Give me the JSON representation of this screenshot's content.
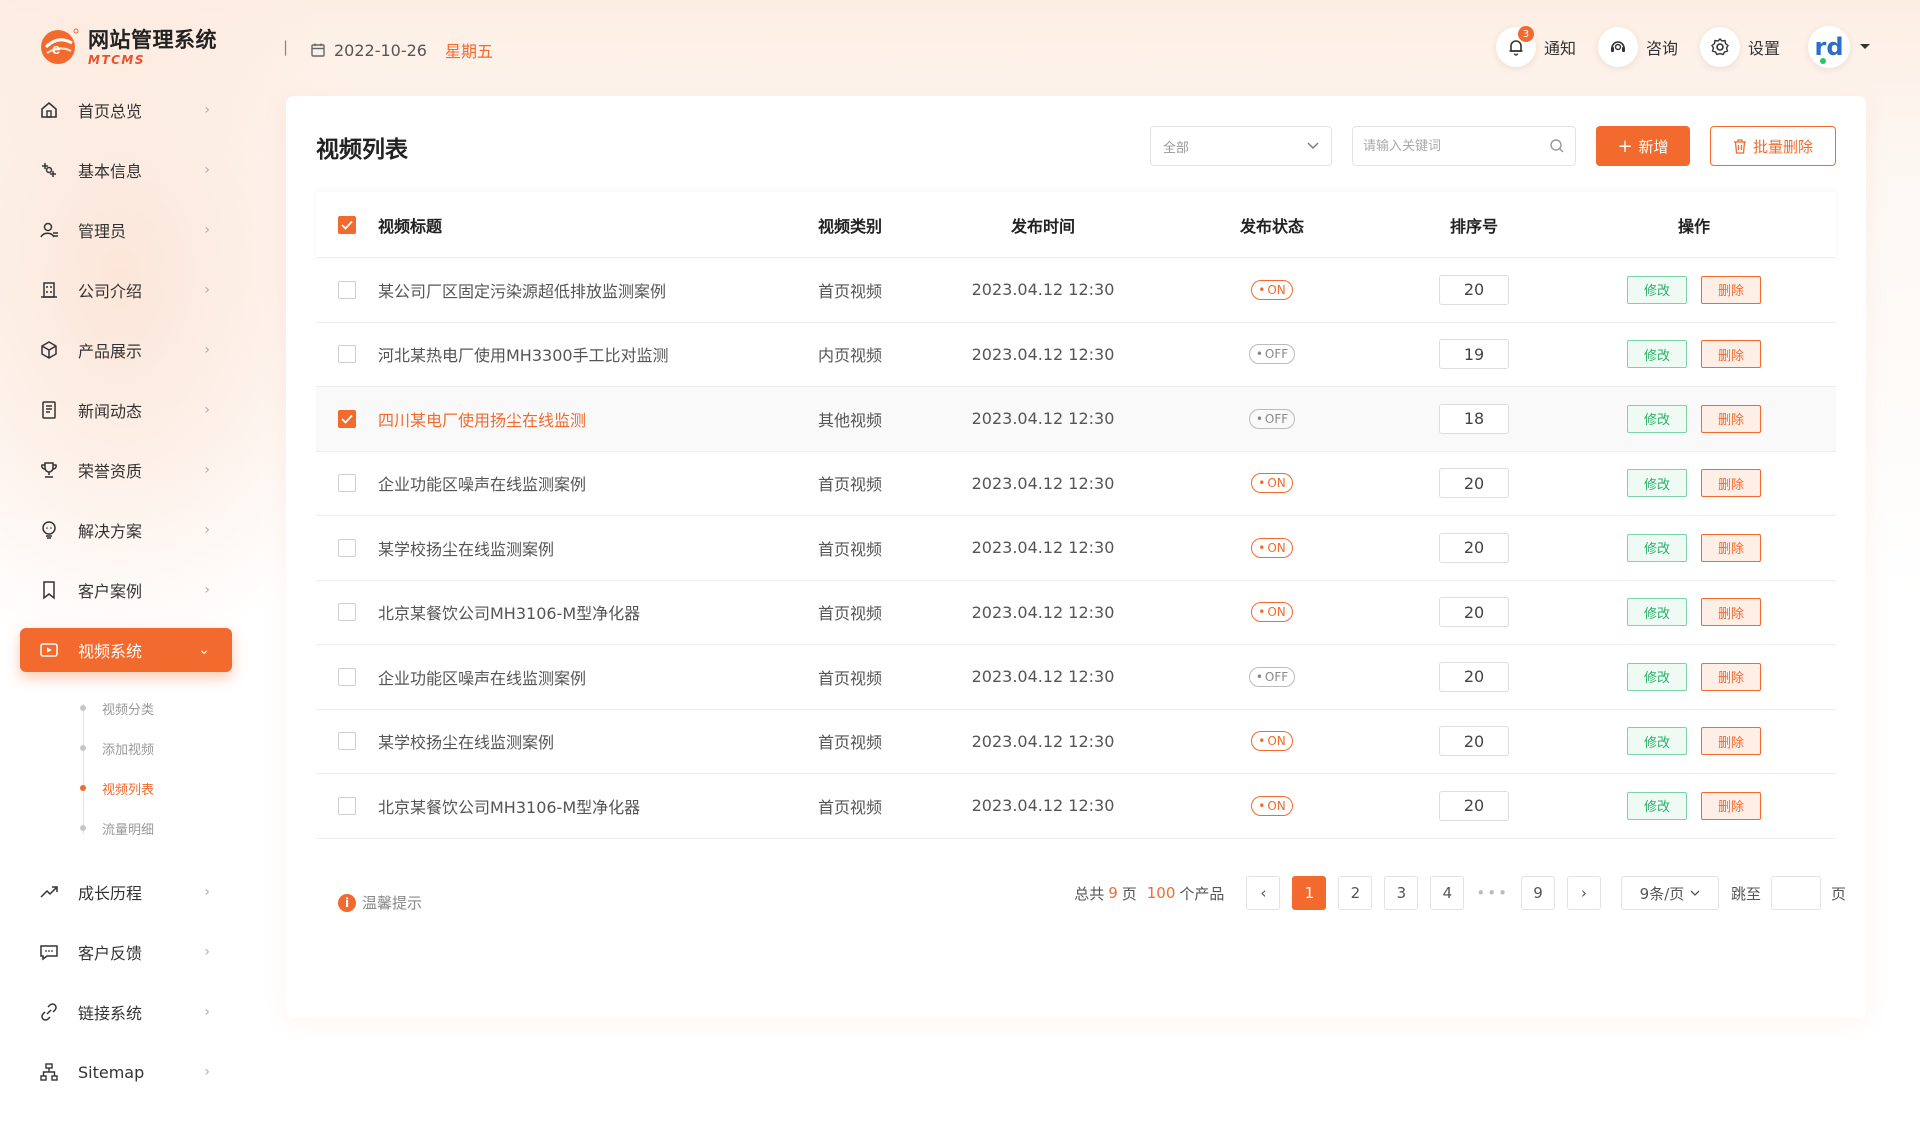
{
  "app": {
    "name_cn": "网站管理系统",
    "name_en": "MTCMS",
    "brand_color": "#f26a2e"
  },
  "header": {
    "separator": "|",
    "date": "2022-10-26",
    "weekday": "星期五",
    "notify_label": "通知",
    "notify_count": "3",
    "consult_label": "咨询",
    "settings_label": "设置",
    "avatar_text": "rd"
  },
  "sidebar": {
    "items": [
      {
        "label": "首页总览",
        "icon": "home-icon"
      },
      {
        "label": "基本信息",
        "icon": "info-icon"
      },
      {
        "label": "管理员",
        "icon": "admin-icon"
      },
      {
        "label": "公司介绍",
        "icon": "building-icon"
      },
      {
        "label": "产品展示",
        "icon": "box-icon"
      },
      {
        "label": "新闻动态",
        "icon": "news-icon"
      },
      {
        "label": "荣誉资质",
        "icon": "trophy-icon"
      },
      {
        "label": "解决方案",
        "icon": "solution-icon"
      },
      {
        "label": "客户案例",
        "icon": "bookmark-icon"
      },
      {
        "label": "视频系统",
        "icon": "video-icon",
        "active": true
      },
      {
        "label": "成长历程",
        "icon": "trend-icon"
      },
      {
        "label": "客户反馈",
        "icon": "message-icon"
      },
      {
        "label": "链接系统",
        "icon": "link-icon"
      },
      {
        "label": "Sitemap",
        "icon": "sitemap-icon"
      }
    ],
    "video_sub": [
      "视频分类",
      "添加视频",
      "视频列表",
      "流量明细"
    ],
    "video_sub_active": "视频列表"
  },
  "main": {
    "title": "视频列表",
    "filter_value": "全部",
    "search_placeholder": "请输入关键词",
    "add_label": "新增",
    "batch_delete_label": "批量删除",
    "columns": [
      "视频标题",
      "视频类别",
      "发布时间",
      "发布状态",
      "排序号",
      "操作"
    ],
    "rows": [
      {
        "title": "某公司厂区固定污染源超低排放监测案例",
        "category": "首页视频",
        "time": "2023.04.12 12:30",
        "status": "ON",
        "order": "20",
        "selected": false
      },
      {
        "title": "河北某热电厂使用MH3300手工比对监测",
        "category": "内页视频",
        "time": "2023.04.12 12:30",
        "status": "OFF",
        "order": "19",
        "selected": false
      },
      {
        "title": "四川某电厂使用扬尘在线监测",
        "category": "其他视频",
        "time": "2023.04.12 12:30",
        "status": "OFF",
        "order": "18",
        "selected": true
      },
      {
        "title": "企业功能区噪声在线监测案例",
        "category": "首页视频",
        "time": "2023.04.12 12:30",
        "status": "ON",
        "order": "20",
        "selected": false
      },
      {
        "title": "某学校扬尘在线监测案例",
        "category": "首页视频",
        "time": "2023.04.12 12:30",
        "status": "ON",
        "order": "20",
        "selected": false
      },
      {
        "title": "北京某餐饮公司MH3106-M型净化器",
        "category": "首页视频",
        "time": "2023.04.12 12:30",
        "status": "ON",
        "order": "20",
        "selected": false
      },
      {
        "title": "企业功能区噪声在线监测案例",
        "category": "首页视频",
        "time": "2023.04.12 12:30",
        "status": "OFF",
        "order": "20",
        "selected": false
      },
      {
        "title": "某学校扬尘在线监测案例",
        "category": "首页视频",
        "time": "2023.04.12 12:30",
        "status": "ON",
        "order": "20",
        "selected": false
      },
      {
        "title": "北京某餐饮公司MH3106-M型净化器",
        "category": "首页视频",
        "time": "2023.04.12 12:30",
        "status": "ON",
        "order": "20",
        "selected": false
      }
    ],
    "edit_label": "修改",
    "delete_label": "删除"
  },
  "footer": {
    "tip": "温馨提示",
    "total_prefix": "总共",
    "total_pages": "9",
    "pages_unit": "页",
    "total_items": "100",
    "items_unit": "个产品",
    "pages": [
      "1",
      "2",
      "3",
      "4",
      "9"
    ],
    "current_page": "1",
    "page_size": "9条/页",
    "jump_label": "跳至",
    "jump_unit": "页"
  }
}
